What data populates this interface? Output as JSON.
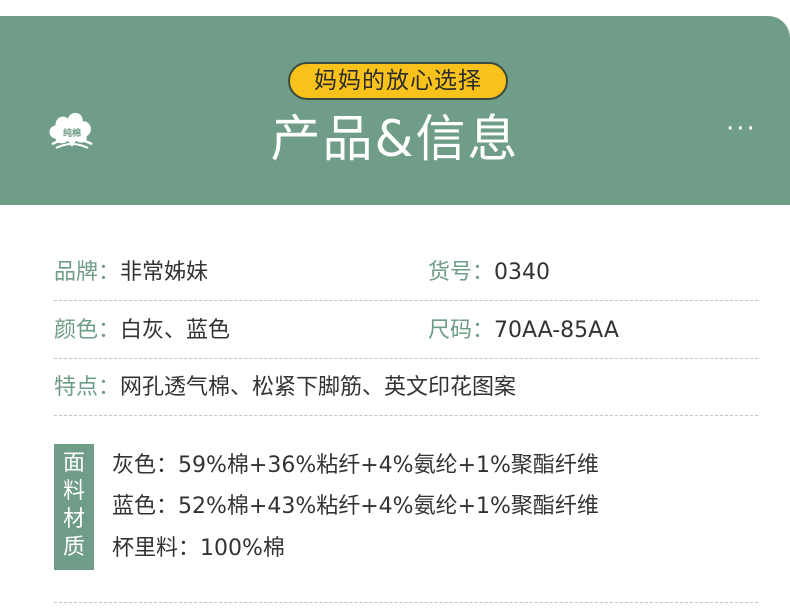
{
  "banner": {
    "pill_text": "妈妈的放心选择",
    "title": "产品&信息",
    "logo_text": "纯棉",
    "more_symbol": "···"
  },
  "info": {
    "brand_label": "品牌：",
    "brand_value": "非常姊妹",
    "item_no_label": "货号：",
    "item_no_value": "0340",
    "color_label": "颜色：",
    "color_value": "白灰、蓝色",
    "size_label": "尺码：",
    "size_value": "70AA-85AA",
    "feature_label": "特点：",
    "feature_value": "网孔透气棉、松紧下脚筋、英文印花图案"
  },
  "material": {
    "heading_chars": [
      "面",
      "料",
      "材",
      "质"
    ],
    "lines": [
      "灰色：59%棉+36%粘纤+4%氨纶+1%聚酯纤维",
      "蓝色：52%棉+43%粘纤+4%氨纶+1%聚酯纤维",
      "杯里料：100%棉"
    ]
  },
  "colors": {
    "accent": "#6f9d87",
    "pill": "#f9c21b"
  }
}
